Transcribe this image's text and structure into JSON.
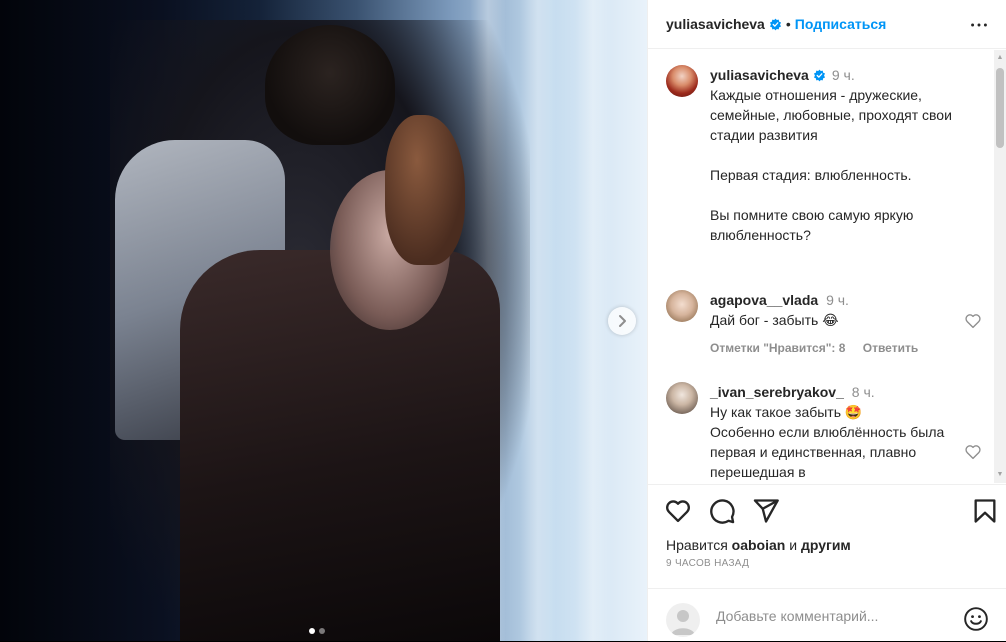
{
  "header": {
    "username": "yuliasavicheva",
    "separator": "•",
    "follow_label": "Подписаться"
  },
  "caption": {
    "username": "yuliasavicheva",
    "time": "9 ч.",
    "text": "Каждые отношения - дружеские, семейные, любовные, проходят свои стадии развития\n\nПервая стадия: влюбленность.\n\nВы помните свою самую яркую влюбленность?"
  },
  "comments": [
    {
      "username": "agapova__vlada",
      "time": "9 ч.",
      "text": "Дай бог - забыть 😂",
      "likes_label": "Отметки \"Нравится\": 8",
      "reply_label": "Ответить"
    },
    {
      "username": "_ivan_serebryakov_",
      "time": "8 ч.",
      "text": "Ну как такое забыть 🤩\nОсобенно если влюблённость была первая и единственная, плавно перешедшая в"
    }
  ],
  "likes": {
    "prefix": "Нравится",
    "user": "oaboian",
    "middle": "и",
    "others": "другим"
  },
  "post_time": "9 ЧАСОВ НАЗАД",
  "comment_input": {
    "placeholder": "Добавьте комментарий..."
  },
  "carousel": {
    "slides": 2,
    "current": 1
  },
  "colors": {
    "accent": "#0095f6",
    "text": "#262626",
    "secondary": "#8e8e8e",
    "verified": "#0095f6"
  },
  "icons": {
    "more": "more-horizontal-icon",
    "heart": "heart-outline-icon",
    "comment": "comment-bubble-icon",
    "share": "paper-plane-icon",
    "save": "bookmark-icon",
    "emoji": "smiley-icon",
    "next": "chevron-right-icon",
    "verified": "verified-badge-icon"
  }
}
